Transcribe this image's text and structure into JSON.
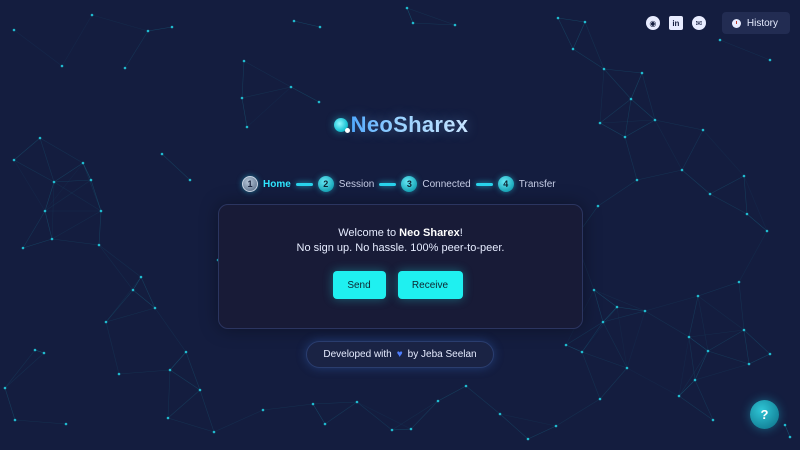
{
  "nav": {
    "social": [
      {
        "name": "github",
        "glyph": "◉"
      },
      {
        "name": "linkedin",
        "glyph": "in"
      },
      {
        "name": "email",
        "glyph": "✉"
      }
    ],
    "history_label": "History"
  },
  "logo": {
    "text": "NeoSharex"
  },
  "stepper": {
    "steps": [
      {
        "num": "1",
        "label": "Home",
        "active": true
      },
      {
        "num": "2",
        "label": "Session",
        "active": false
      },
      {
        "num": "3",
        "label": "Connected",
        "active": false
      },
      {
        "num": "4",
        "label": "Transfer",
        "active": false
      }
    ]
  },
  "card": {
    "welcome_prefix": "Welcome to ",
    "welcome_brand": "Neo Sharex",
    "welcome_suffix": "!",
    "tagline": "No sign up. No hassle. 100% peer-to-peer.",
    "send_label": "Send",
    "receive_label": "Receive"
  },
  "credit": {
    "prefix": "Developed with",
    "heart": "♥",
    "suffix": "by Jeba Seelan"
  },
  "help": {
    "label": "?"
  },
  "colors": {
    "background": "#141d3f",
    "accent": "#1ff0f0",
    "particle": "#22d3e6"
  }
}
